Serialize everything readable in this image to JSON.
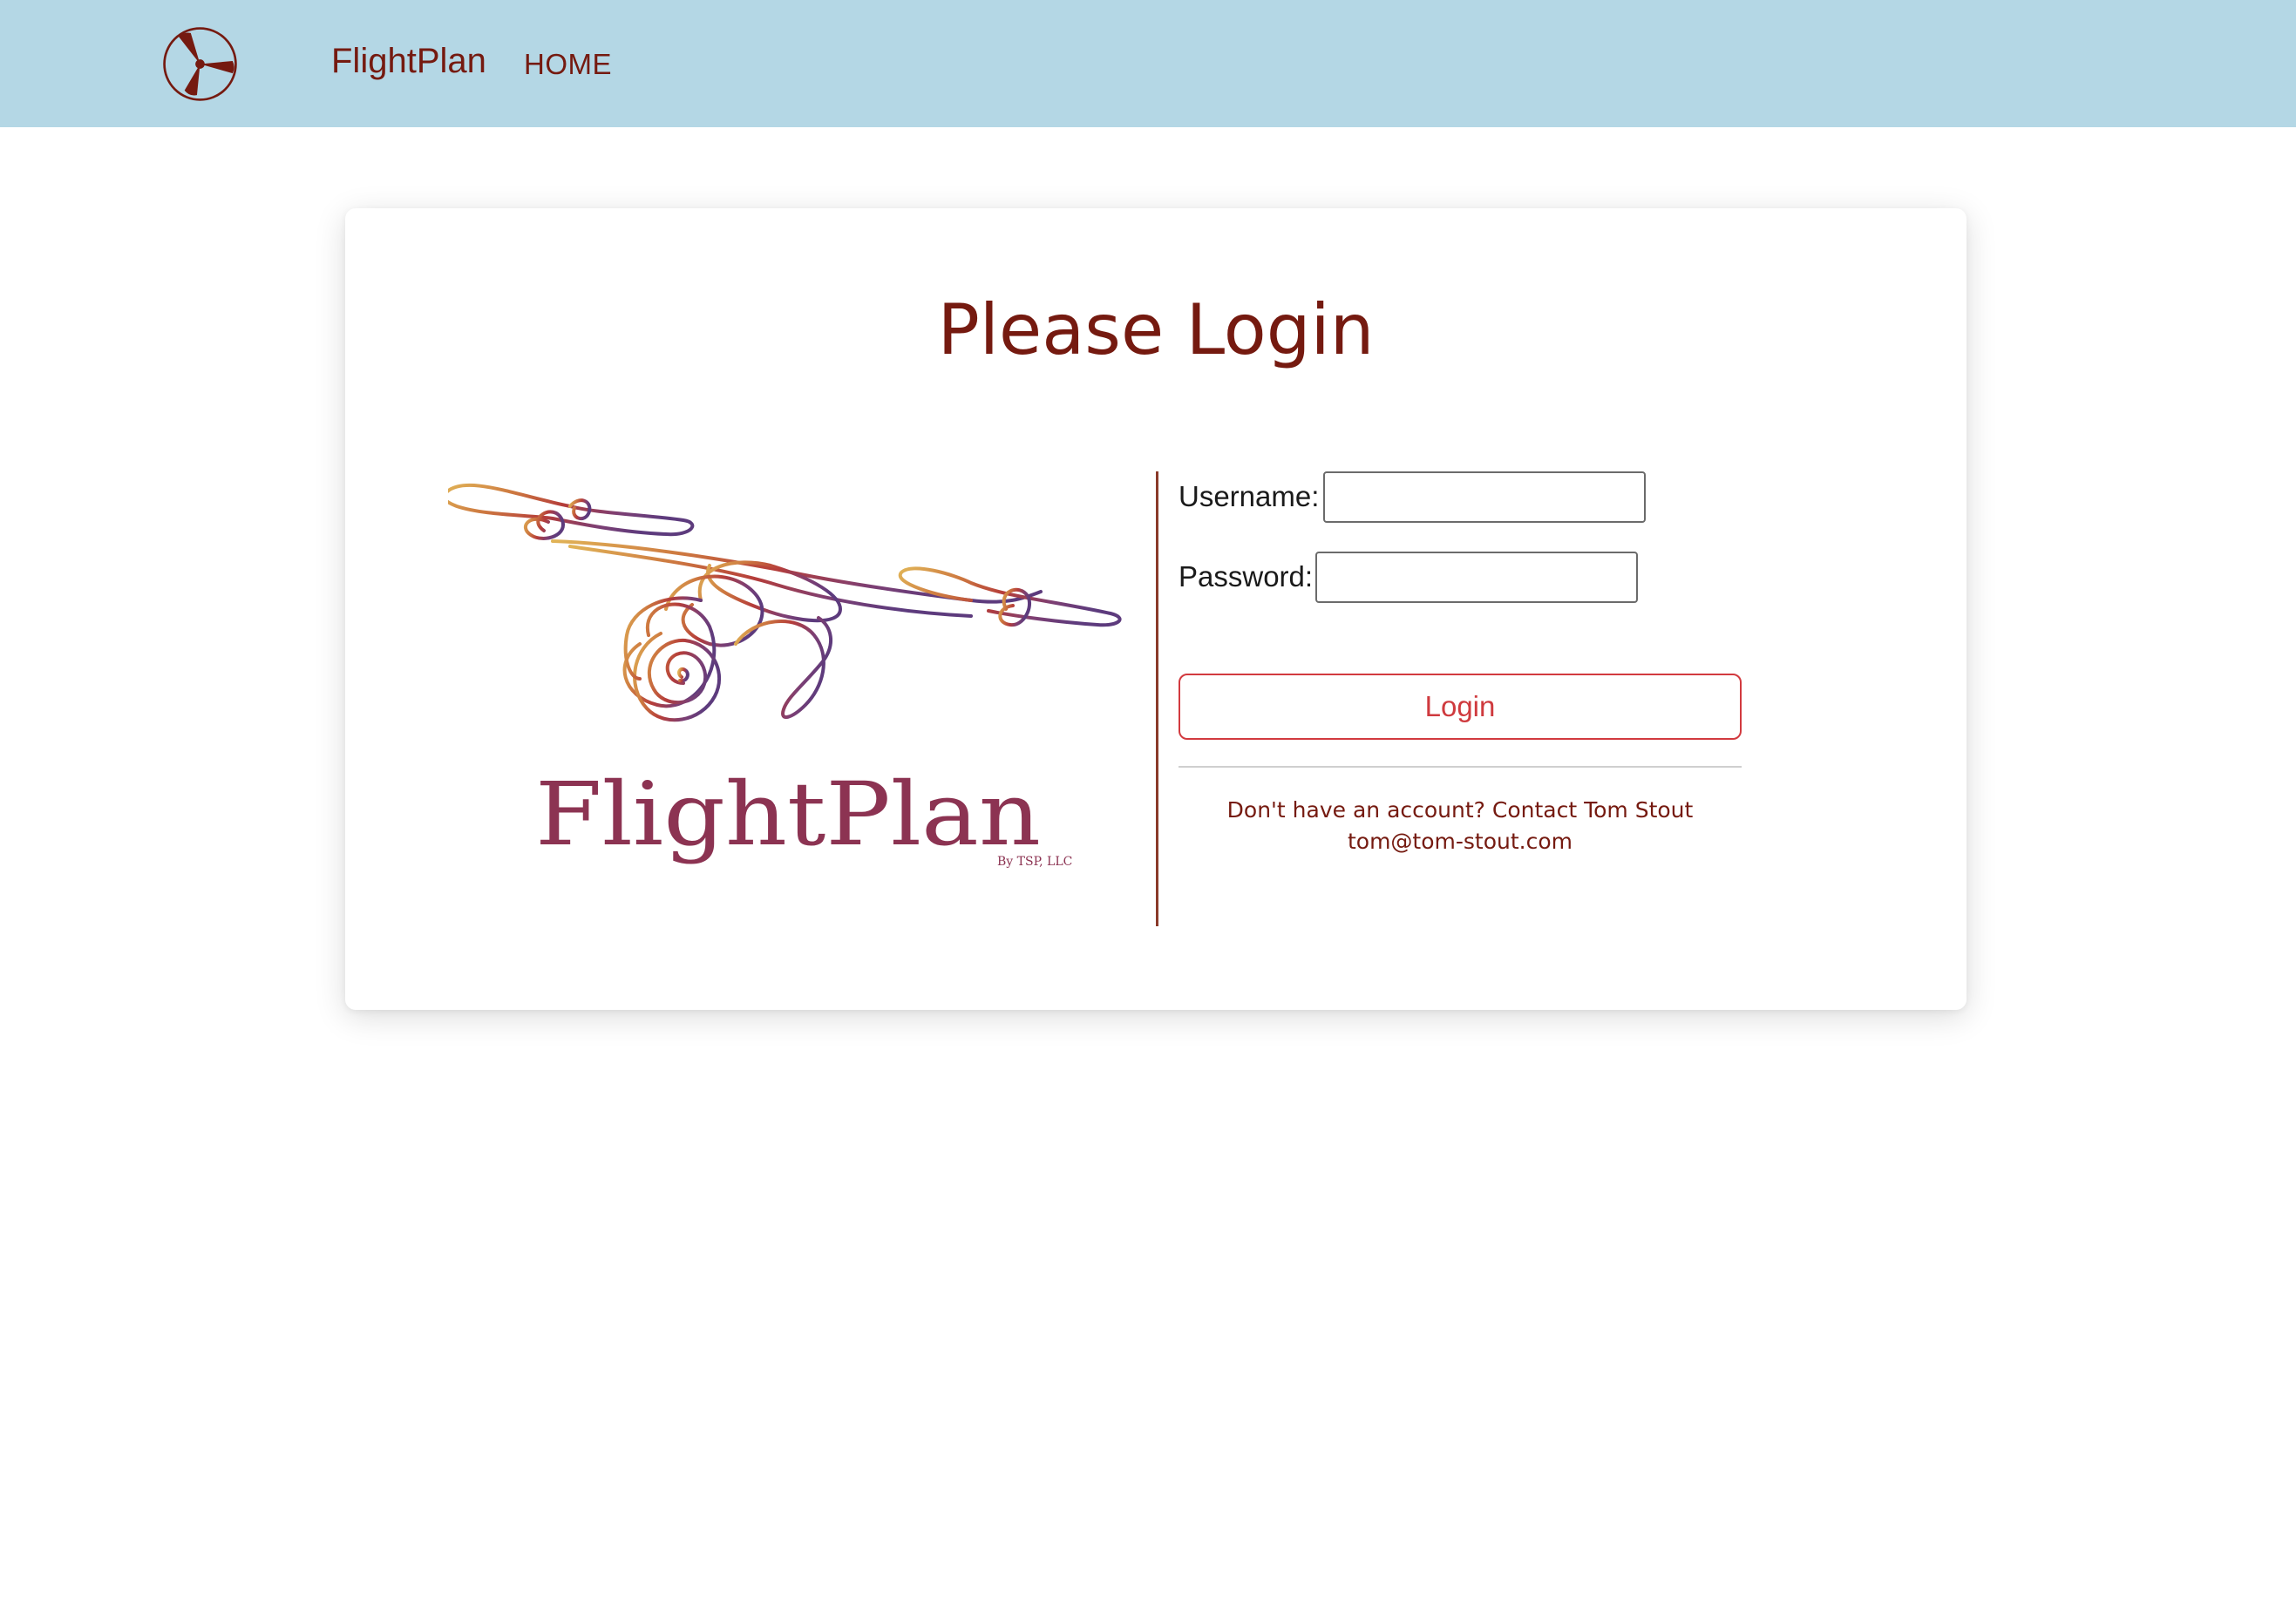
{
  "navbar": {
    "logo_icon": "propeller-icon",
    "brand": "FlightPlan",
    "links": [
      {
        "label": "HOME"
      }
    ]
  },
  "card": {
    "title": "Please Login",
    "hero": {
      "icon": "airplane-doodle-icon",
      "logo_text": "FlightPlan",
      "logo_subtext": "By TSP, LLC"
    },
    "form": {
      "username_label": "Username:",
      "username_value": "",
      "password_label": "Password:",
      "password_value": "",
      "login_button": "Login"
    },
    "signup": {
      "line1": "Don't have an account? Contact Tom Stout",
      "line2": "tom@tom-stout.com"
    }
  },
  "colors": {
    "navbar_bg": "#b4d7e5",
    "brand": "#751a10",
    "accent_button": "#cf3a3e",
    "divider": "#8a3a2a"
  }
}
